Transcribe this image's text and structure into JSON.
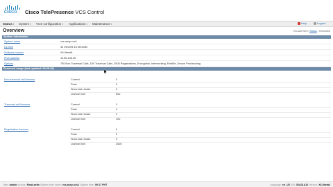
{
  "header": {
    "logo_text": "CISCO",
    "brand": "Cisco TelePresence",
    "product": "VCS Control"
  },
  "nav": [
    {
      "label": "Status",
      "active": true
    },
    {
      "label": "System",
      "active": false
    },
    {
      "label": "VCS configuration",
      "active": false
    },
    {
      "label": "Applications",
      "active": false
    },
    {
      "label": "Maintenance",
      "active": false
    }
  ],
  "top_links": {
    "help": "Help",
    "logout": "Logout"
  },
  "page": {
    "title": "Overview",
    "breadcrumb_prefix": "You are here:",
    "breadcrumb_link": "Status",
    "breadcrumb_current": "Overview"
  },
  "system_info": {
    "heading": "System information",
    "rows": [
      {
        "label": "System name",
        "value": "vcs-assy-vcs1"
      },
      {
        "label": "Up time",
        "value": "43 minutes 16 seconds"
      },
      {
        "label": "Software version",
        "value": "X6.0beta6"
      },
      {
        "label": "IPv4 address",
        "value": "10.66.146.26"
      },
      {
        "label": "Options",
        "value": "750 Non Traversal Calls, 150 Traversal Calls, 2500 Registrations, Encryption, Interworking, FindMe, Device Provisioning"
      }
    ]
  },
  "resource": {
    "heading": "Resource usage (last updated: 09:25:38)",
    "groups": [
      {
        "label": "Non-traversal call licenses",
        "rows": [
          {
            "k": "Current",
            "v": "0"
          },
          {
            "k": "Peak",
            "v": "0"
          },
          {
            "k": "Since last restart",
            "v": "0"
          },
          {
            "k": "License limit",
            "v": "500"
          }
        ]
      },
      {
        "label": "Traversal call licenses",
        "rows": [
          {
            "k": "Current",
            "v": "0"
          },
          {
            "k": "Peak",
            "v": "0"
          },
          {
            "k": "Since last restart",
            "v": "0"
          },
          {
            "k": "License limit",
            "v": "100"
          }
        ]
      },
      {
        "label": "Registration licenses",
        "rows": [
          {
            "k": "Current",
            "v": "0"
          },
          {
            "k": "Peak",
            "v": "0"
          },
          {
            "k": "Since last restart",
            "v": "0"
          },
          {
            "k": "License limit",
            "v": "2500"
          }
        ]
      }
    ]
  },
  "status_bar": {
    "user_k": "User:",
    "user_v": "admin",
    "access_k": "Access:",
    "access_v": "Read-write",
    "system_k": "System host name:",
    "system_v": "vcs-assy-vcs1",
    "time_k": "System time:",
    "time_v": "09:17 PHT",
    "lang_k": "Language:",
    "lang_v": "en_US",
    "serial_k": "S/N:",
    "serial_v": "52A01A10",
    "ver_k": "Version:",
    "ver_v": "X6.0beta6"
  }
}
